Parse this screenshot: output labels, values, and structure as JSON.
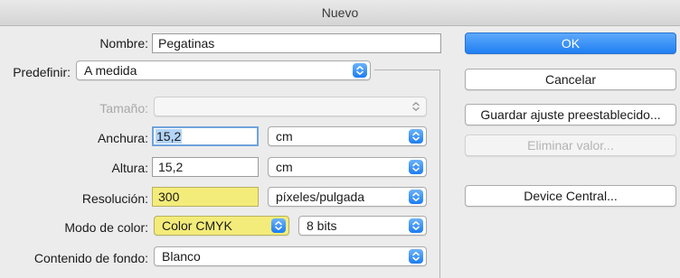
{
  "window": {
    "title": "Nuevo"
  },
  "form": {
    "nombre": {
      "label": "Nombre:",
      "value": "Pegatinas"
    },
    "predefinir": {
      "label": "Predefinir:",
      "value": "A medida"
    },
    "tamano": {
      "label": "Tamaño:",
      "value": ""
    },
    "anchura": {
      "label": "Anchura:",
      "value": "15,2",
      "unit": "cm"
    },
    "altura": {
      "label": "Altura:",
      "value": "15,2",
      "unit": "cm"
    },
    "resolucion": {
      "label": "Resolución:",
      "value": "300",
      "unit": "píxeles/pulgada"
    },
    "modo_color": {
      "label": "Modo de color:",
      "value": "Color CMYK",
      "bits": "8 bits"
    },
    "contenido_fondo": {
      "label": "Contenido de fondo:",
      "value": "Blanco"
    }
  },
  "buttons": {
    "ok": "OK",
    "cancelar": "Cancelar",
    "guardar": "Guardar ajuste preestablecido...",
    "eliminar": "Eliminar valor...",
    "device_central": "Device Central..."
  },
  "colors": {
    "accent": "#1f7ff2",
    "highlight_yellow": "#f3ec7a",
    "window_bg": "#ececec"
  },
  "icons": {
    "select_arrows": "chevron-up-down-icon"
  }
}
